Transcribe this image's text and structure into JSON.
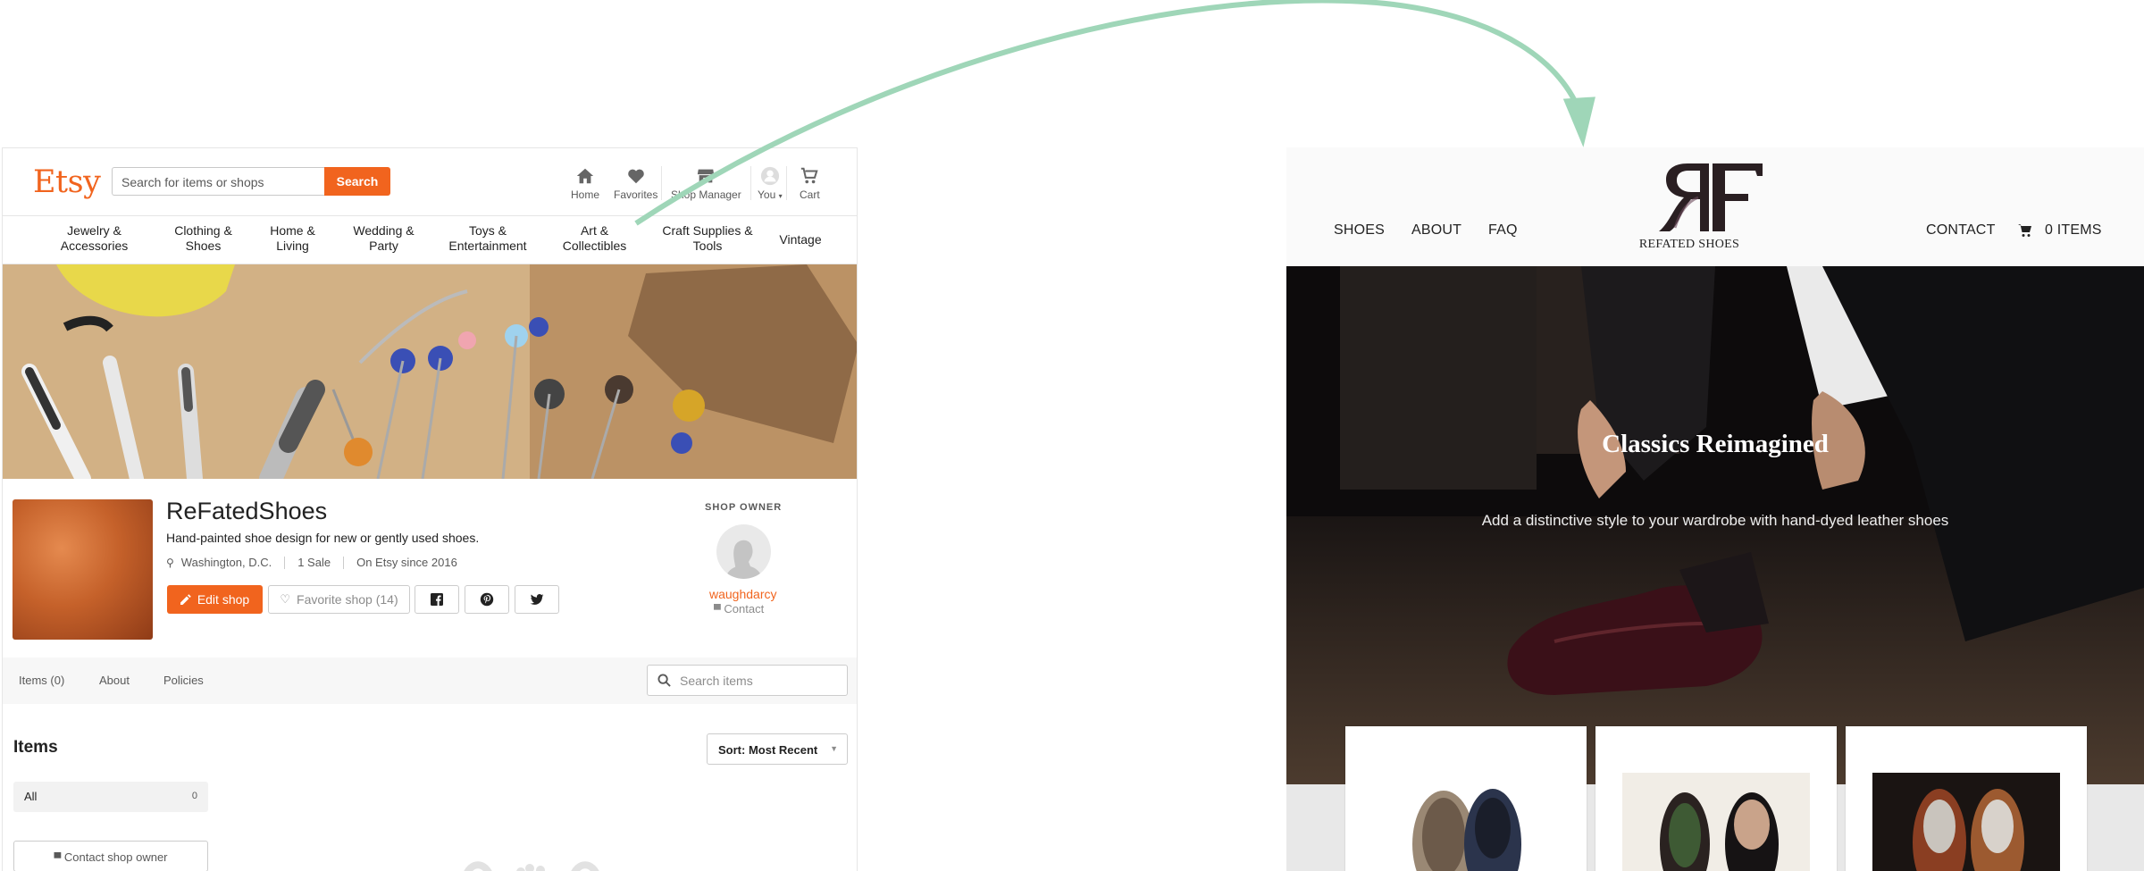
{
  "etsy": {
    "logo": "Etsy",
    "search": {
      "placeholder": "Search for items or shops",
      "button": "Search"
    },
    "nav": [
      {
        "label": "Home",
        "icon": "home-icon"
      },
      {
        "label": "Favorites",
        "icon": "heart-icon"
      },
      {
        "label": "Shop Manager",
        "icon": "shop-icon"
      },
      {
        "label": "You",
        "icon": "user-avatar-icon"
      },
      {
        "label": "Cart",
        "icon": "cart-icon"
      }
    ],
    "categories": [
      "Jewelry &\nAccessories",
      "Clothing &\nShoes",
      "Home &\nLiving",
      "Wedding &\nParty",
      "Toys &\nEntertainment",
      "Art &\nCollectibles",
      "Craft Supplies &\nTools",
      "Vintage"
    ],
    "shop": {
      "name": "ReFatedShoes",
      "description": "Hand-painted shoe design for new or gently used shoes.",
      "location": "Washington, D.C.",
      "sales": "1 Sale",
      "since": "On Etsy since 2016",
      "edit_button": "Edit shop",
      "favorite_button": "Favorite shop (14)"
    },
    "owner": {
      "label": "SHOP OWNER",
      "name": "waughdarcy",
      "contact": "Contact"
    },
    "tabs": [
      "Items (0)",
      "About",
      "Policies"
    ],
    "items_search_placeholder": "Search items",
    "items_title": "Items",
    "sort_label": "Sort: Most Recent",
    "all_label": "All",
    "all_count": "0",
    "contact_owner": "Contact shop owner",
    "accent_color": "#f1641e"
  },
  "refated": {
    "nav_left": [
      "SHOES",
      "ABOUT",
      "FAQ"
    ],
    "logo_text": "REFATED SHOES",
    "contact": "CONTACT",
    "cart": "0 ITEMS",
    "hero_title": "Classics Reimagined",
    "hero_subtitle": "Add a distinctive style to your wardrobe with hand-dyed leather shoes",
    "logo_color": "#2a1f22"
  },
  "arrow_color": "#9fd6b8"
}
